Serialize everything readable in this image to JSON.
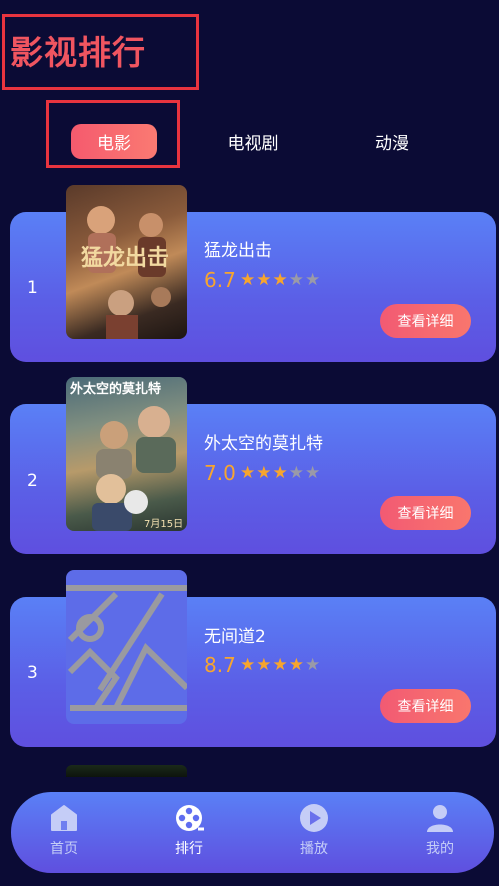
{
  "page_title": "影视排行",
  "tabs": [
    {
      "label": "电影",
      "active": true
    },
    {
      "label": "电视剧",
      "active": false
    },
    {
      "label": "动漫",
      "active": false
    }
  ],
  "movies": [
    {
      "rank": "1",
      "title": "猛龙出击",
      "score": "6.7",
      "stars": 3,
      "button": "查看详细"
    },
    {
      "rank": "2",
      "title": "外太空的莫扎特",
      "score": "7.0",
      "stars": 3,
      "button": "查看详细"
    },
    {
      "rank": "3",
      "title": "无间道2",
      "score": "8.7",
      "stars": 4,
      "button": "查看详细"
    }
  ],
  "bottom_nav": [
    {
      "label": "首页",
      "icon": "home-icon",
      "active": false
    },
    {
      "label": "排行",
      "icon": "film-reel-icon",
      "active": true
    },
    {
      "label": "播放",
      "icon": "play-icon",
      "active": false
    },
    {
      "label": "我的",
      "icon": "user-icon",
      "active": false
    }
  ],
  "colors": {
    "background": "#0b0b35",
    "accent": "#f55a6e",
    "score": "#f7a52e",
    "nav_inactive": "#c5cdf7"
  }
}
